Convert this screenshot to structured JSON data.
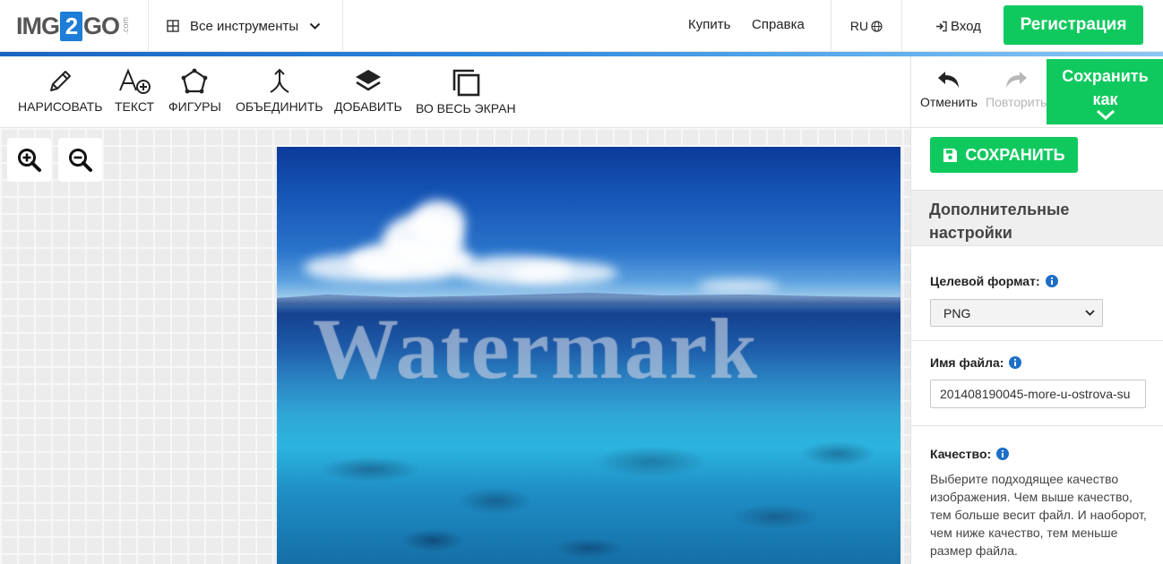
{
  "header": {
    "logo": {
      "left": "IMG",
      "digit": "2",
      "right": "GO",
      "suffix": ".com"
    },
    "tools_menu_label": "Все инструменты",
    "buy_label": "Купить",
    "help_label": "Справка",
    "language": "RU",
    "login_label": "Вход",
    "register_label": "Регистрация"
  },
  "toolbar": {
    "tools": [
      {
        "label": "НАРИСОВАТЬ",
        "icon": "pencil-icon"
      },
      {
        "label": "ТЕКСТ",
        "icon": "add-text-icon"
      },
      {
        "label": "ФИГУРЫ",
        "icon": "shapes-icon"
      },
      {
        "label": "ОБЪЕДИНИТЬ",
        "icon": "merge-icon"
      },
      {
        "label": "ДОБАВИТЬ",
        "icon": "layers-icon"
      },
      {
        "label": "ВО ВЕСЬ ЭКРАН",
        "icon": "fullscreen-icon"
      }
    ],
    "undo_label": "Отменить",
    "redo_label": "Повторить",
    "save_as_label_line1": "Сохранить",
    "save_as_label_line2": "как"
  },
  "canvas": {
    "zoom_in_icon": "zoom-in-icon",
    "zoom_out_icon": "zoom-out-icon",
    "watermark_text": "Watermark"
  },
  "panel": {
    "save_label": "СОХРАНИТЬ",
    "advanced_title": "Дополнительные настройки",
    "format_label": "Целевой формат:",
    "format_value": "PNG",
    "filename_label": "Имя файла:",
    "filename_value": "201408190045-more-u-ostrova-su",
    "quality_label": "Качество:",
    "quality_description": "Выберите подходящее качество изображения. Чем выше качество, тем больше весит файл. И наоборот, чем ниже качество, тем меньше размер файла."
  },
  "colors": {
    "accent_green": "#10c95e",
    "brand_blue": "#1e7dd6"
  }
}
